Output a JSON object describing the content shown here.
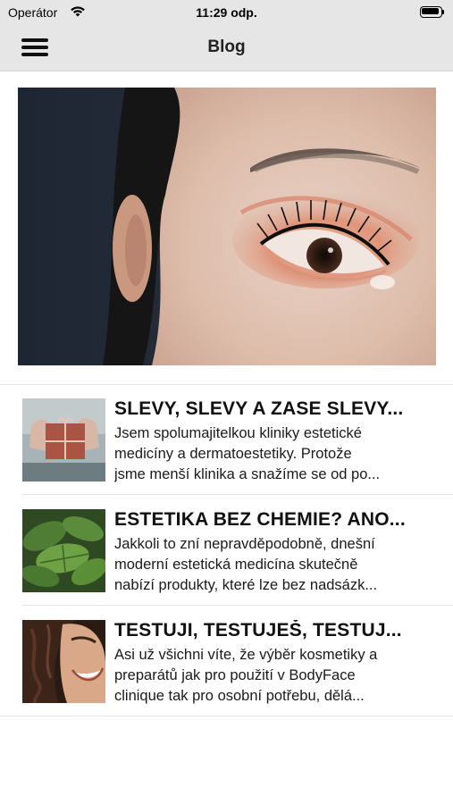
{
  "status_bar": {
    "carrier": "Operátor",
    "time": "11:29 odp.",
    "wifi_icon": "wifi-icon",
    "battery_icon": "battery-icon"
  },
  "nav": {
    "title": "Blog",
    "menu_icon": "hamburger-menu-icon"
  },
  "hero": {
    "image": "close-up eye with rose-gold eyeshadow"
  },
  "posts": [
    {
      "title": "SLEVY, SLEVY A ZASE SLEVY...",
      "excerpt": [
        "Jsem spolumajitelkou kliniky estetické",
        "medicíny a dermatoestetiky. Protože",
        "jsme menší klinika a snažíme se od po..."
      ],
      "thumbnail": "pink gift box held in hands"
    },
    {
      "title": "ESTETIKA BEZ CHEMIE? ANO...",
      "excerpt": [
        "Jakkoli to zní nepravděpodobně, dnešní",
        "moderní estetická medicína skutečně",
        "nabízí produkty, které lze bez nadsázk..."
      ],
      "thumbnail": "green nettle leaves"
    },
    {
      "title": "TESTUJI, TESTUJEŠ, TESTUJ...",
      "excerpt": [
        "Asi už všichni víte, že výběr kosmetiky a",
        "preparátů jak pro použití v BodyFace",
        "clinique tak pro osobní potřebu, dělá..."
      ],
      "thumbnail": "smiling woman with curly hair"
    }
  ]
}
